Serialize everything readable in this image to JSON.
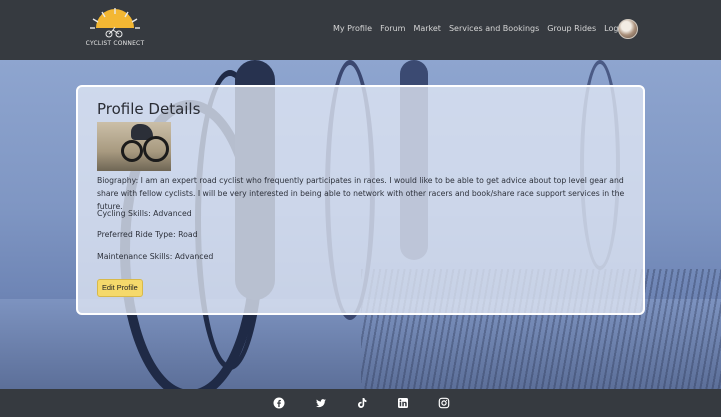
{
  "brand": {
    "name": "CYCLIST CONNECT",
    "tagline": "CYCLING COMMUNITY"
  },
  "nav": {
    "items": [
      "My Profile",
      "Forum",
      "Market",
      "Services and Bookings",
      "Group Rides",
      "Logout"
    ]
  },
  "profile": {
    "title": "Profile Details",
    "biography": "Biography: I am an expert road cyclist who frequently participates in races. I would like to be able to get advice about top level gear and share with fellow cyclists. I will be very interested in being able to network with other racers and book/share race support services in the future.",
    "cycling_skills": "Cycling Skills: Advanced",
    "ride_type": "Preferred Ride Type: Road",
    "maintenance_skills": "Maintenance Skills: Advanced",
    "edit_label": "Edit Profile"
  },
  "footer": {
    "social_icons": [
      "facebook-icon",
      "twitter-icon",
      "tiktok-icon",
      "linkedin-icon",
      "instagram-icon"
    ]
  },
  "colors": {
    "navbar": "#363a40",
    "accent_button": "#f5d96b",
    "card_border": "#ffffff"
  }
}
